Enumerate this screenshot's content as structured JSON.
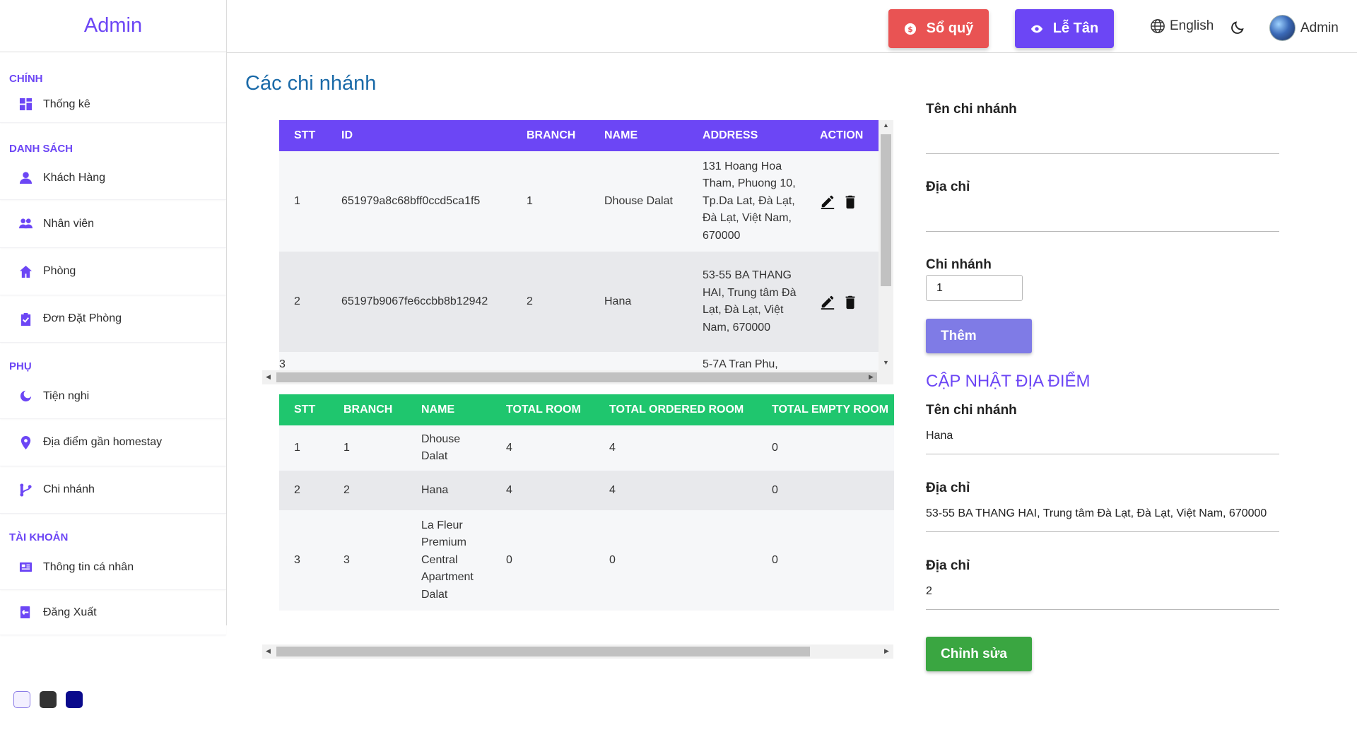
{
  "sidebar": {
    "brand": "Admin",
    "sections": {
      "main": "CHÍNH",
      "list": "DANH SÁCH",
      "extra": "PHỤ",
      "account": "TÀI KHOẢN"
    },
    "items": {
      "stats": "Thống kê",
      "customers": "Khách Hàng",
      "staff": "Nhân viên",
      "rooms": "Phòng",
      "bookings": "Đơn Đặt Phòng",
      "amenities": "Tiện nghi",
      "nearby": "Địa điểm gần homestay",
      "branches": "Chi nhánh",
      "profile": "Thông tin cá nhân",
      "logout": "Đăng Xuất"
    },
    "theme_colors": [
      "#f3f0ff",
      "#333333",
      "#0a0a8c"
    ]
  },
  "header": {
    "soquy_label": "Sổ quỹ",
    "letan_label": "Lễ Tân",
    "language": "English",
    "user_name": "Admin"
  },
  "main": {
    "title": "Các chi nhánh",
    "branch_table": {
      "headers": [
        "STT",
        "ID",
        "BRANCH",
        "NAME",
        "ADDRESS",
        "ACTION"
      ],
      "rows": [
        {
          "stt": "1",
          "id": "651979a8c68bff0ccd5ca1f5",
          "branch": "1",
          "name": "Dhouse Dalat",
          "address": "131 Hoang Hoa Tham, Phuong 10, Tp.Da Lat, Đà Lạt, Đà Lạt, Việt Nam, 670000"
        },
        {
          "stt": "2",
          "id": "65197b9067fe6ccbb8b12942",
          "branch": "2",
          "name": "Hana",
          "address": "53-55 BA THANG HAI, Trung tâm Đà Lạt, Đà Lạt, Việt Nam, 670000"
        },
        {
          "stt": "3",
          "id": "",
          "branch": "",
          "name": "",
          "address": "5-7A Tran Phu,"
        }
      ]
    },
    "stats_table": {
      "headers": [
        "STT",
        "BRANCH",
        "NAME",
        "TOTAL ROOM",
        "TOTAL ORDERED ROOM",
        "TOTAL EMPTY ROOM"
      ],
      "rows": [
        {
          "stt": "1",
          "branch": "1",
          "name": "Dhouse Dalat",
          "total": "4",
          "ordered": "4",
          "empty": "0"
        },
        {
          "stt": "2",
          "branch": "2",
          "name": "Hana",
          "total": "4",
          "ordered": "4",
          "empty": "0"
        },
        {
          "stt": "3",
          "branch": "3",
          "name": "La Fleur Premium Central Apartment Dalat",
          "total": "0",
          "ordered": "0",
          "empty": "0"
        }
      ]
    }
  },
  "form": {
    "add": {
      "name_label": "Tên chi nhánh",
      "name_value": "",
      "address_label": "Địa chỉ",
      "address_value": "",
      "branch_label": "Chi nhánh",
      "branch_value": "1",
      "submit_label": "Thêm"
    },
    "update": {
      "title": "CẬP NHẬT ĐỊA ĐIỂM",
      "name_label": "Tên chi nhánh",
      "name_value": "Hana",
      "address_label": "Địa chỉ",
      "address_value": "53-55 BA THANG HAI, Trung tâm Đà Lạt, Đà Lạt, Việt Nam, 670000",
      "branch_label": "Địa chỉ",
      "branch_value": "2",
      "submit_label": "Chỉnh sửa"
    }
  }
}
